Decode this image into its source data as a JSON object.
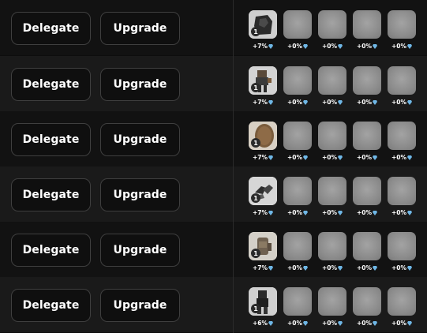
{
  "buttons": {
    "delegate_label": "Delegate",
    "upgrade_label": "Upgrade"
  },
  "gem_icon": "gem-icon",
  "colors": {
    "gem": "#6fb7e6",
    "button_border": "#3f3f3f",
    "slot_empty": "#8c8c8c"
  },
  "rows": [
    {
      "item_icon": "armor-bundle-icon",
      "level": "1",
      "slots": [
        "+7%",
        "+0%",
        "+0%",
        "+0%",
        "+0%"
      ]
    },
    {
      "item_icon": "armor-set-icon",
      "level": "1",
      "slots": [
        "+7%",
        "+0%",
        "+0%",
        "+0%",
        "+0%"
      ]
    },
    {
      "item_icon": "shield-icon",
      "level": "1",
      "slots": [
        "+7%",
        "+0%",
        "+0%",
        "+0%",
        "+0%"
      ]
    },
    {
      "item_icon": "gauntlets-icon",
      "level": "1",
      "slots": [
        "+7%",
        "+0%",
        "+0%",
        "+0%",
        "+0%"
      ]
    },
    {
      "item_icon": "backpack-icon",
      "level": "1",
      "slots": [
        "+7%",
        "+0%",
        "+0%",
        "+0%",
        "+0%"
      ]
    },
    {
      "item_icon": "armor-stand-icon",
      "level": "1",
      "slots": [
        "+6%",
        "+0%",
        "+0%",
        "+0%",
        "+0%"
      ]
    }
  ]
}
